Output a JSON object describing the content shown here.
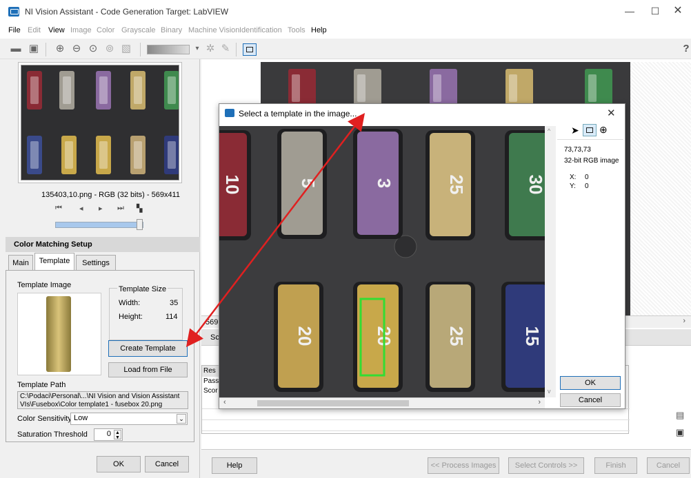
{
  "window": {
    "title": "NI Vision Assistant - Code Generation Target: LabVIEW"
  },
  "menu": [
    "File",
    "Edit",
    "View",
    "Image",
    "Color",
    "Grayscale",
    "Binary",
    "Machine Vision",
    "Identification",
    "Tools",
    "Help"
  ],
  "thumbnail": {
    "caption": "135403,10.png - RGB (32 bits) - 569x411"
  },
  "setup": {
    "title": "Color Matching Setup",
    "tabs": [
      "Main",
      "Template",
      "Settings"
    ],
    "template_image_label": "Template Image",
    "template_size_label": "Template Size",
    "width_label": "Width:",
    "width_value": "35",
    "height_label": "Height:",
    "height_value": "114",
    "create_template": "Create Template",
    "load_from_file": "Load from File",
    "template_path_label": "Template Path",
    "template_path_line1": "C:\\Podaci\\Personal\\...\\NI Vision and Vision Assistant",
    "template_path_line2": "VIs\\Fusebox\\Color template1 - fusebox 20.png",
    "color_sensitivity_label": "Color Sensitivity",
    "color_sensitivity_value": "Low",
    "saturation_label": "Saturation Threshold",
    "saturation_value": "0",
    "ok": "OK",
    "cancel": "Cancel"
  },
  "dialog": {
    "title": "Select a template in the image...",
    "pixel_value": "73,73,73",
    "image_type": "32-bit RGB image",
    "x_label": "X:",
    "x_value": "0",
    "y_label": "Y:",
    "y_value": "0",
    "ok": "OK",
    "cancel": "Cancel",
    "fuse_labels": [
      "10",
      "5",
      "3",
      "25",
      "30",
      "20",
      "20",
      "25",
      "15"
    ]
  },
  "main": {
    "partial_size": "569:",
    "partial_sc": "Sc",
    "partial_res": "Res",
    "partial_pass": "Pass",
    "partial_scor": "Scor"
  },
  "footer": {
    "help": "Help",
    "process_images": "<< Process Images",
    "select_controls": "Select Controls >>",
    "finish": "Finish",
    "cancel": "Cancel"
  },
  "colors": {
    "accent": "#1e6fb8",
    "selection": "#33dd33",
    "arrow": "#e02020"
  }
}
